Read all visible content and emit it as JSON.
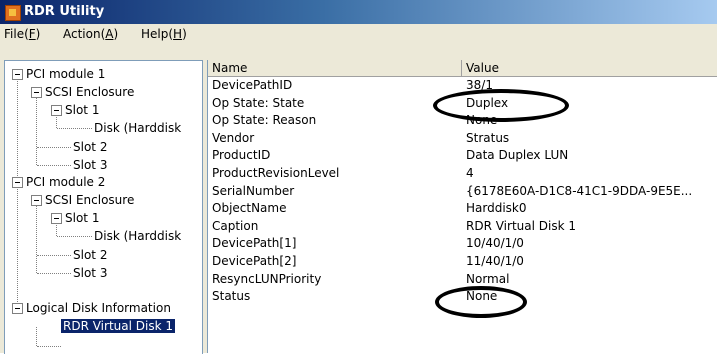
{
  "window": {
    "title": "RDR Utility"
  },
  "menu": [
    {
      "label": "File(",
      "key": "F",
      "suffix": ")"
    },
    {
      "label": "Action(",
      "key": "A",
      "suffix": ")"
    },
    {
      "label": "Help(",
      "key": "H",
      "suffix": ")"
    }
  ],
  "tree": {
    "pci1": "PCI module 1",
    "pci1_enclosure": "SCSI Enclosure",
    "pci1_slot1": "Slot 1",
    "pci1_disk": "Disk (Harddisk",
    "pci1_slot2": "Slot 2",
    "pci1_slot3": "Slot 3",
    "pci2": "PCI module 2",
    "pci2_enclosure": "SCSI Enclosure",
    "pci2_slot1": "Slot 1",
    "pci2_disk": "Disk (Harddisk",
    "pci2_slot2": "Slot 2",
    "pci2_slot3": "Slot 3",
    "logical": "Logical Disk Information",
    "virtual_disk": "RDR Virtual Disk 1"
  },
  "table": {
    "columns": [
      "Name",
      "Value"
    ],
    "rows": [
      {
        "name": "DevicePathID",
        "value": "38/1"
      },
      {
        "name": "Op State: State",
        "value": "Duplex"
      },
      {
        "name": "Op State: Reason",
        "value": "None"
      },
      {
        "name": "Vendor",
        "value": "Stratus"
      },
      {
        "name": "ProductID",
        "value": "Data Duplex LUN"
      },
      {
        "name": "ProductRevisionLevel",
        "value": "4"
      },
      {
        "name": "SerialNumber",
        "value": "{6178E60A-D1C8-41C1-9DDA-9E5E..."
      },
      {
        "name": "ObjectName",
        "value": "Harddisk0"
      },
      {
        "name": "Caption",
        "value": "RDR Virtual Disk 1"
      },
      {
        "name": "DevicePath[1]",
        "value": "10/40/1/0"
      },
      {
        "name": "DevicePath[2]",
        "value": "11/40/1/0"
      },
      {
        "name": "ResyncLUNPriority",
        "value": "Normal"
      },
      {
        "name": "Status",
        "value": "None"
      }
    ]
  }
}
